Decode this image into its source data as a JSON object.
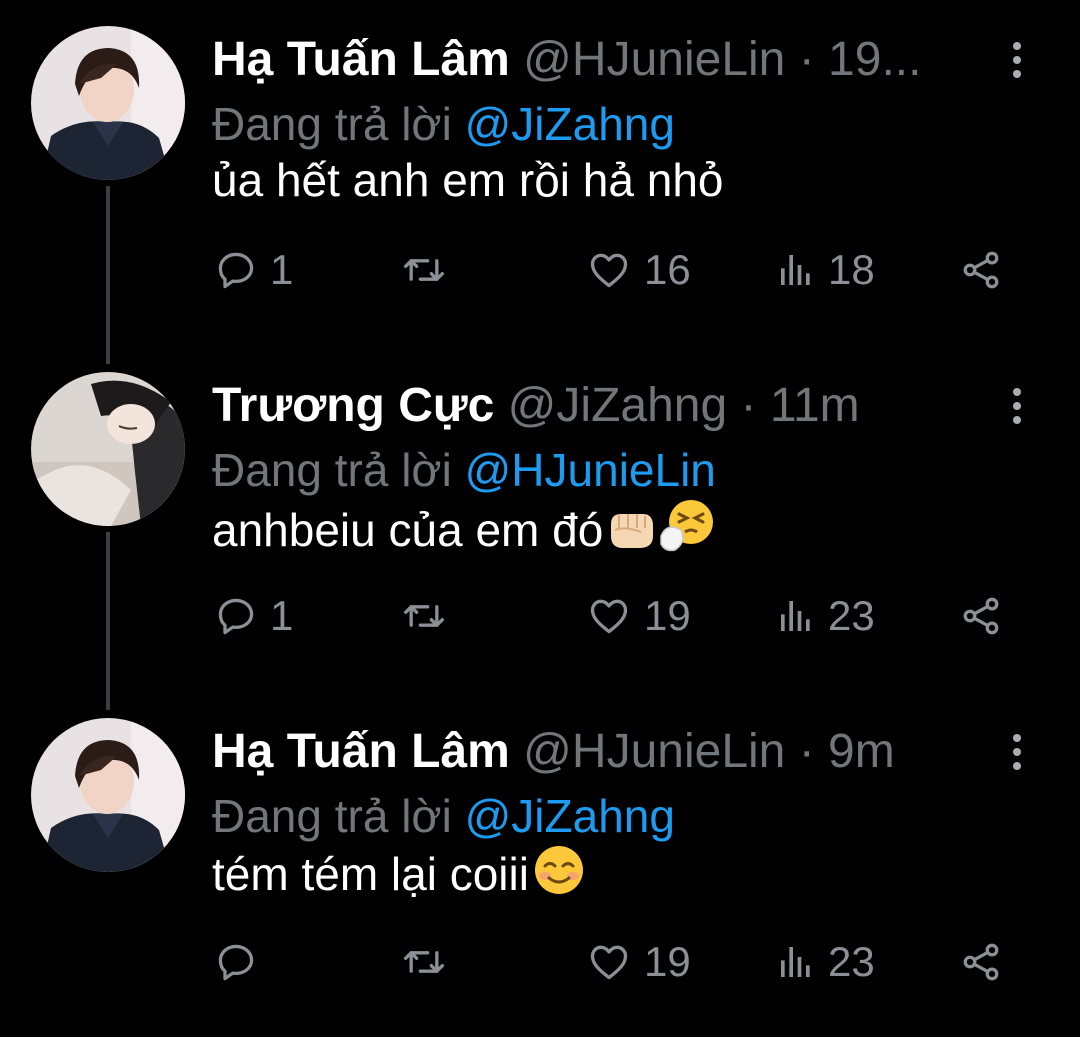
{
  "tweets": [
    {
      "name": "Hạ Tuấn Lâm",
      "handle": "@HJunieLin",
      "time": "19...",
      "reply_label": "Đang trả lời",
      "reply_to": "@JiZahng",
      "text": "ủa hết anh em rồi hả nhỏ",
      "emoji": [],
      "replies": "1",
      "retweets": "",
      "likes": "16",
      "views": "18",
      "avatar": "user-avatar-boy-dark-shirt"
    },
    {
      "name": "Trương Cực",
      "handle": "@JiZahng",
      "time": "11m",
      "reply_label": "Đang trả lời",
      "reply_to": "@HJunieLin",
      "text": "anhbeiu của em đó",
      "emoji": [
        "fist-emoji",
        "sneezing-face-emoji"
      ],
      "replies": "1",
      "retweets": "",
      "likes": "19",
      "views": "23",
      "avatar": "user-avatar-profile-light"
    },
    {
      "name": "Hạ Tuấn Lâm",
      "handle": "@HJunieLin",
      "time": "9m",
      "reply_label": "Đang trả lời",
      "reply_to": "@JiZahng",
      "text": "tém tém lại coiii",
      "emoji": [
        "smiling-face-emoji"
      ],
      "replies": "",
      "retweets": "",
      "likes": "19",
      "views": "23",
      "avatar": "user-avatar-boy-dark-shirt"
    }
  ],
  "colors": {
    "background": "#000000",
    "mention": "#1d9bf0",
    "secondary_text": "#71767b",
    "thread_line": "#3a3f44"
  }
}
